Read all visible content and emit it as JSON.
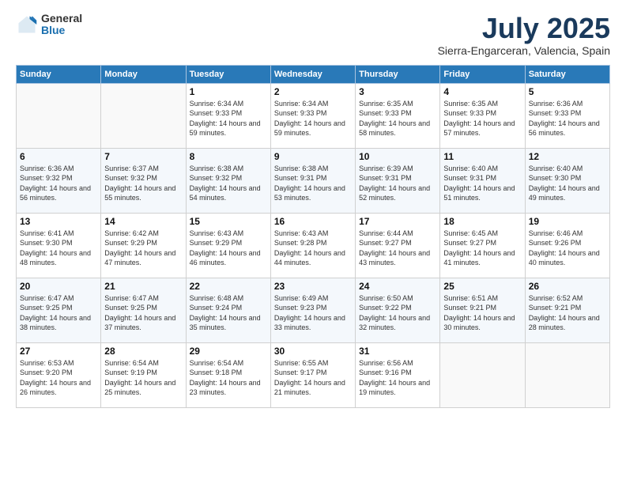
{
  "logo": {
    "general": "General",
    "blue": "Blue"
  },
  "title": {
    "month_year": "July 2025",
    "location": "Sierra-Engarceran, Valencia, Spain"
  },
  "days_of_week": [
    "Sunday",
    "Monday",
    "Tuesday",
    "Wednesday",
    "Thursday",
    "Friday",
    "Saturday"
  ],
  "weeks": [
    [
      {
        "day": "",
        "info": ""
      },
      {
        "day": "",
        "info": ""
      },
      {
        "day": "1",
        "info": "Sunrise: 6:34 AM\nSunset: 9:33 PM\nDaylight: 14 hours and 59 minutes."
      },
      {
        "day": "2",
        "info": "Sunrise: 6:34 AM\nSunset: 9:33 PM\nDaylight: 14 hours and 59 minutes."
      },
      {
        "day": "3",
        "info": "Sunrise: 6:35 AM\nSunset: 9:33 PM\nDaylight: 14 hours and 58 minutes."
      },
      {
        "day": "4",
        "info": "Sunrise: 6:35 AM\nSunset: 9:33 PM\nDaylight: 14 hours and 57 minutes."
      },
      {
        "day": "5",
        "info": "Sunrise: 6:36 AM\nSunset: 9:33 PM\nDaylight: 14 hours and 56 minutes."
      }
    ],
    [
      {
        "day": "6",
        "info": "Sunrise: 6:36 AM\nSunset: 9:32 PM\nDaylight: 14 hours and 56 minutes."
      },
      {
        "day": "7",
        "info": "Sunrise: 6:37 AM\nSunset: 9:32 PM\nDaylight: 14 hours and 55 minutes."
      },
      {
        "day": "8",
        "info": "Sunrise: 6:38 AM\nSunset: 9:32 PM\nDaylight: 14 hours and 54 minutes."
      },
      {
        "day": "9",
        "info": "Sunrise: 6:38 AM\nSunset: 9:31 PM\nDaylight: 14 hours and 53 minutes."
      },
      {
        "day": "10",
        "info": "Sunrise: 6:39 AM\nSunset: 9:31 PM\nDaylight: 14 hours and 52 minutes."
      },
      {
        "day": "11",
        "info": "Sunrise: 6:40 AM\nSunset: 9:31 PM\nDaylight: 14 hours and 51 minutes."
      },
      {
        "day": "12",
        "info": "Sunrise: 6:40 AM\nSunset: 9:30 PM\nDaylight: 14 hours and 49 minutes."
      }
    ],
    [
      {
        "day": "13",
        "info": "Sunrise: 6:41 AM\nSunset: 9:30 PM\nDaylight: 14 hours and 48 minutes."
      },
      {
        "day": "14",
        "info": "Sunrise: 6:42 AM\nSunset: 9:29 PM\nDaylight: 14 hours and 47 minutes."
      },
      {
        "day": "15",
        "info": "Sunrise: 6:43 AM\nSunset: 9:29 PM\nDaylight: 14 hours and 46 minutes."
      },
      {
        "day": "16",
        "info": "Sunrise: 6:43 AM\nSunset: 9:28 PM\nDaylight: 14 hours and 44 minutes."
      },
      {
        "day": "17",
        "info": "Sunrise: 6:44 AM\nSunset: 9:27 PM\nDaylight: 14 hours and 43 minutes."
      },
      {
        "day": "18",
        "info": "Sunrise: 6:45 AM\nSunset: 9:27 PM\nDaylight: 14 hours and 41 minutes."
      },
      {
        "day": "19",
        "info": "Sunrise: 6:46 AM\nSunset: 9:26 PM\nDaylight: 14 hours and 40 minutes."
      }
    ],
    [
      {
        "day": "20",
        "info": "Sunrise: 6:47 AM\nSunset: 9:25 PM\nDaylight: 14 hours and 38 minutes."
      },
      {
        "day": "21",
        "info": "Sunrise: 6:47 AM\nSunset: 9:25 PM\nDaylight: 14 hours and 37 minutes."
      },
      {
        "day": "22",
        "info": "Sunrise: 6:48 AM\nSunset: 9:24 PM\nDaylight: 14 hours and 35 minutes."
      },
      {
        "day": "23",
        "info": "Sunrise: 6:49 AM\nSunset: 9:23 PM\nDaylight: 14 hours and 33 minutes."
      },
      {
        "day": "24",
        "info": "Sunrise: 6:50 AM\nSunset: 9:22 PM\nDaylight: 14 hours and 32 minutes."
      },
      {
        "day": "25",
        "info": "Sunrise: 6:51 AM\nSunset: 9:21 PM\nDaylight: 14 hours and 30 minutes."
      },
      {
        "day": "26",
        "info": "Sunrise: 6:52 AM\nSunset: 9:21 PM\nDaylight: 14 hours and 28 minutes."
      }
    ],
    [
      {
        "day": "27",
        "info": "Sunrise: 6:53 AM\nSunset: 9:20 PM\nDaylight: 14 hours and 26 minutes."
      },
      {
        "day": "28",
        "info": "Sunrise: 6:54 AM\nSunset: 9:19 PM\nDaylight: 14 hours and 25 minutes."
      },
      {
        "day": "29",
        "info": "Sunrise: 6:54 AM\nSunset: 9:18 PM\nDaylight: 14 hours and 23 minutes."
      },
      {
        "day": "30",
        "info": "Sunrise: 6:55 AM\nSunset: 9:17 PM\nDaylight: 14 hours and 21 minutes."
      },
      {
        "day": "31",
        "info": "Sunrise: 6:56 AM\nSunset: 9:16 PM\nDaylight: 14 hours and 19 minutes."
      },
      {
        "day": "",
        "info": ""
      },
      {
        "day": "",
        "info": ""
      }
    ]
  ]
}
